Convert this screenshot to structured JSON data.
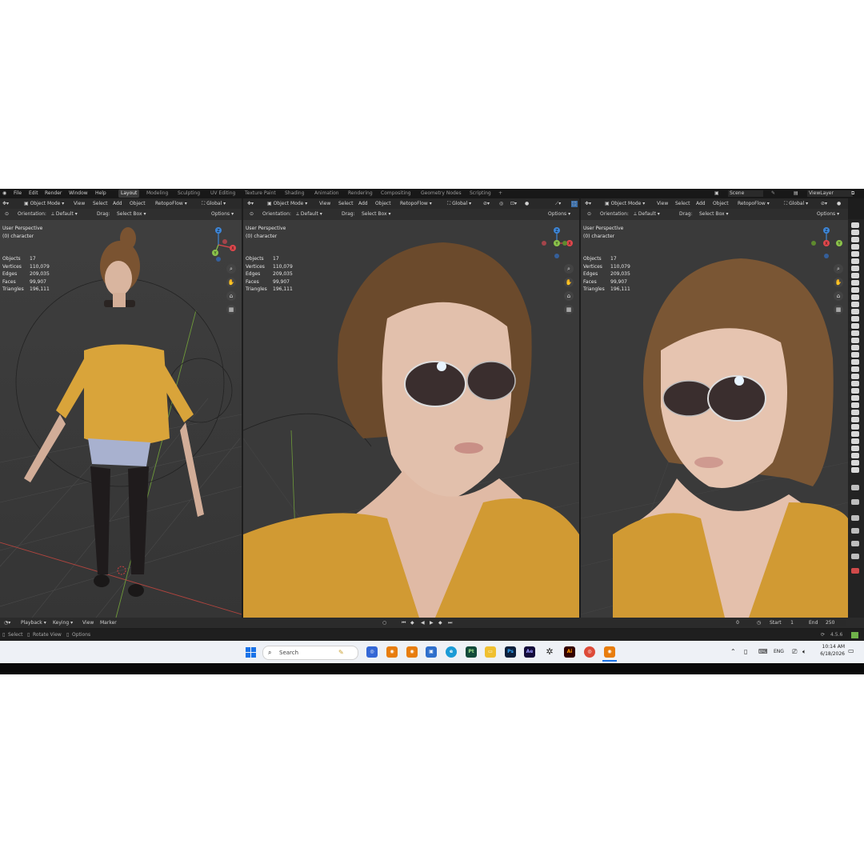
{
  "menu": {
    "items": [
      "File",
      "Edit",
      "Render",
      "Window",
      "Help"
    ],
    "workspaces": [
      "Layout",
      "Modeling",
      "Sculpting",
      "UV Editing",
      "Texture Paint",
      "Shading",
      "Animation",
      "Rendering",
      "Compositing",
      "Geometry Nodes",
      "Scripting"
    ],
    "active_workspace": "Layout",
    "add_tab": "+",
    "scene_label": "Scene",
    "view_layer_label": "ViewLayer"
  },
  "viewport_header": {
    "mode": "Object Mode",
    "menus": [
      "View",
      "Select",
      "Add",
      "Object"
    ],
    "addon": "RetopoFlow",
    "transform_orientation": "Global",
    "orientation_label": "Orientation:",
    "orientation_value": "Default",
    "drag_label": "Drag:",
    "drag_value": "Select Box",
    "options_label": "Options"
  },
  "viewports": [
    {
      "view_name": "User Perspective",
      "collection": "(0) character",
      "stats": [
        {
          "label": "Objects",
          "value": "17"
        },
        {
          "label": "Vertices",
          "value": "110,079"
        },
        {
          "label": "Edges",
          "value": "209,035"
        },
        {
          "label": "Faces",
          "value": "99,907"
        },
        {
          "label": "Triangles",
          "value": "196,111"
        }
      ]
    },
    {
      "view_name": "User Perspective",
      "collection": "(0) character",
      "stats": [
        {
          "label": "Objects",
          "value": "17"
        },
        {
          "label": "Vertices",
          "value": "110,079"
        },
        {
          "label": "Edges",
          "value": "209,035"
        },
        {
          "label": "Faces",
          "value": "99,907"
        },
        {
          "label": "Triangles",
          "value": "196,111"
        }
      ]
    },
    {
      "view_name": "User Perspective",
      "collection": "(0) character",
      "stats": [
        {
          "label": "Objects",
          "value": "17"
        },
        {
          "label": "Vertices",
          "value": "110,079"
        },
        {
          "label": "Edges",
          "value": "209,035"
        },
        {
          "label": "Faces",
          "value": "99,907"
        },
        {
          "label": "Triangles",
          "value": "196,111"
        }
      ]
    }
  ],
  "gizmo_axes": {
    "z": "Z",
    "y": "Y",
    "x": "X"
  },
  "timeline": {
    "menus": [
      "Playback",
      "Keying",
      "View",
      "Marker"
    ],
    "current_frame": "0",
    "start_label": "Start",
    "start_value": "1",
    "end_label": "End",
    "end_value": "250"
  },
  "statusbar": {
    "hints": [
      "Select",
      "Rotate View",
      "Options"
    ],
    "version": "4.5.6"
  },
  "taskbar": {
    "search_placeholder": "Search",
    "tray_language": "ENG",
    "time": "10:14 AM",
    "date": "6/18/2026",
    "app_labels": [
      "Pt",
      "Ps",
      "Ae",
      "Ai"
    ]
  },
  "colors": {
    "accent_yellow": "#d9a43a",
    "axis_x": "#e0474c",
    "axis_y": "#8bc34a",
    "axis_z": "#3d86d8"
  }
}
